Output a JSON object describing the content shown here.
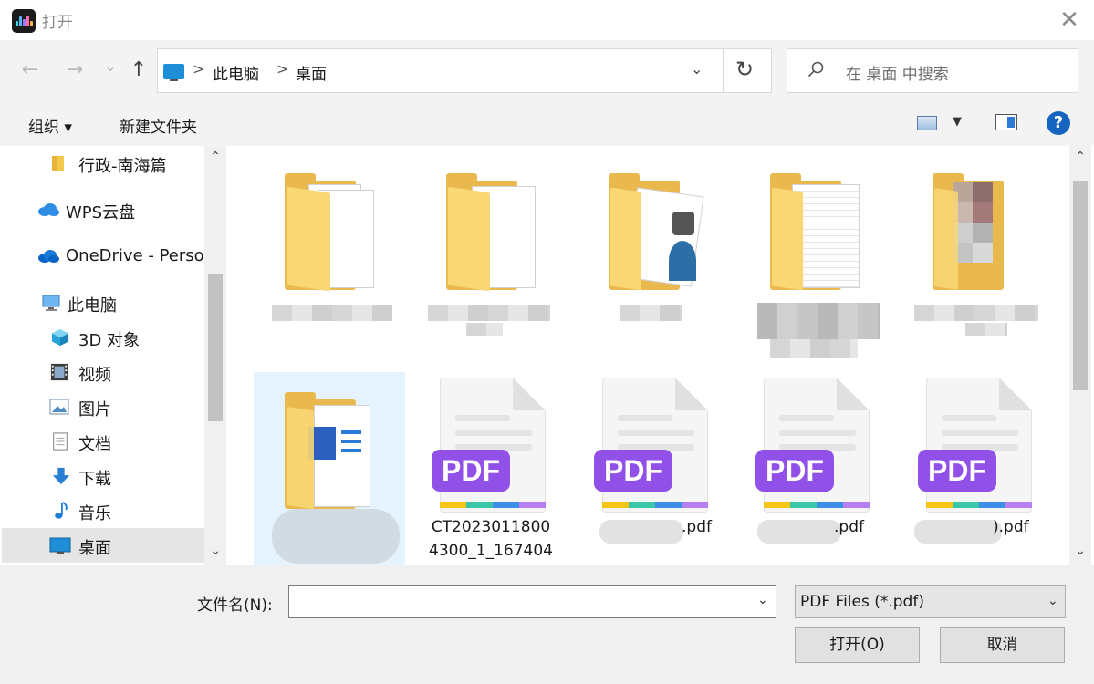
{
  "window": {
    "title": "打开",
    "close_glyph": "✕"
  },
  "nav": {
    "back_glyph": "←",
    "forward_glyph": "→",
    "recent_glyph": "⌄",
    "up_glyph": "↑",
    "breadcrumbs": [
      "此电脑",
      "桌面"
    ],
    "separator": ">",
    "dropdown_glyph": "⌄",
    "refresh_glyph": "↻"
  },
  "search": {
    "placeholder": "在 桌面 中搜索"
  },
  "toolbar": {
    "organize_label": "组织 ▾",
    "new_folder_label": "新建文件夹",
    "view_dropdown_glyph": "▼",
    "help_glyph": "?"
  },
  "sidebar": {
    "items": [
      {
        "label": "行政-南海篇",
        "icon": "folder-icon"
      },
      {
        "label": "WPS云盘",
        "icon": "cloud-icon"
      },
      {
        "label": "OneDrive - Perso",
        "icon": "onedrive-icon"
      },
      {
        "label": "此电脑",
        "icon": "computer-icon"
      },
      {
        "label": "3D 对象",
        "icon": "cube-icon"
      },
      {
        "label": "视频",
        "icon": "video-icon"
      },
      {
        "label": "图片",
        "icon": "picture-icon"
      },
      {
        "label": "文档",
        "icon": "document-icon"
      },
      {
        "label": "下载",
        "icon": "download-icon"
      },
      {
        "label": "音乐",
        "icon": "music-icon"
      },
      {
        "label": "桌面",
        "icon": "desktop-icon"
      }
    ],
    "scroll_up": "⌃",
    "scroll_down": "⌄"
  },
  "files": {
    "pdf_badge": "PDF",
    "items": [
      {
        "label_line1": "CT2023011800",
        "label_line2": "4300_1_167404"
      },
      {
        "label_suffix": ".pdf"
      },
      {
        "label_suffix": ".pdf"
      },
      {
        "label_suffix": ").pdf"
      }
    ],
    "scroll_up": "⌃",
    "scroll_down": "⌄"
  },
  "bottom": {
    "filename_label": "文件名(N):",
    "filename_value": "",
    "filetype_value": "PDF Files (*.pdf)",
    "dropdown_glyph": "⌄",
    "open_label": "打开(O)",
    "cancel_label": "取消"
  },
  "colors": {
    "accent": "#1e8ed6",
    "pdf_badge": "#9150e8",
    "folder": "#f8d774",
    "selection": "#e5f3ff"
  }
}
